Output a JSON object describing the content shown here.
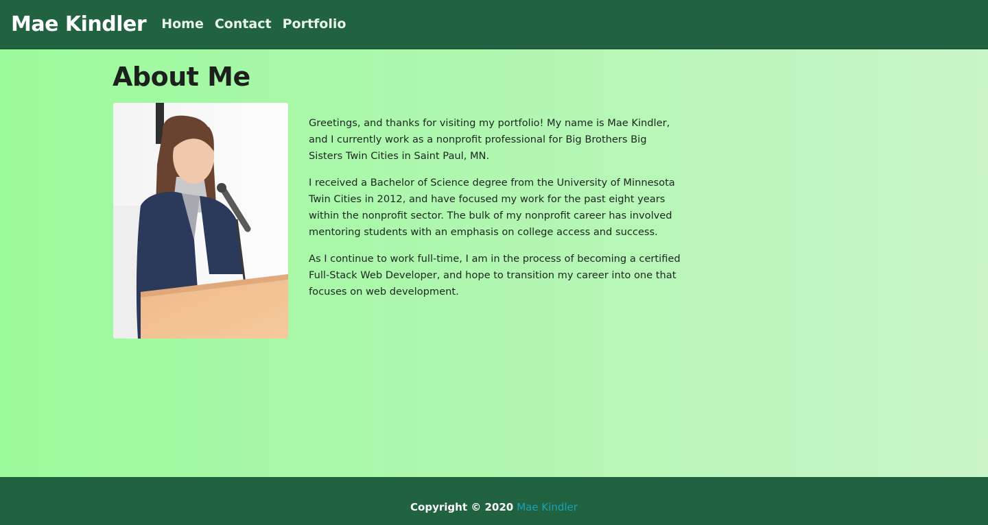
{
  "navbar": {
    "brand": "Mae Kindler",
    "links": [
      {
        "label": "Home"
      },
      {
        "label": "Contact"
      },
      {
        "label": "Portfolio"
      }
    ]
  },
  "main": {
    "title": "About Me",
    "photo": {
      "alt": "Mae Kindler speaking at a podium"
    },
    "paragraphs": [
      "Greetings, and thanks for visiting my portfolio! My name is Mae Kindler, and I currently work as a nonprofit professional for Big Brothers Big Sisters Twin Cities in Saint Paul, MN.",
      "I received a Bachelor of Science degree from the University of Minnesota Twin Cities in 2012, and have focused my work for the past eight years within the nonprofit sector. The bulk of my nonprofit career has involved mentoring students with an emphasis on college access and success.",
      "As I continue to work full-time, I am in the process of becoming a certified Full-Stack Web Developer, and hope to transition my career into one that focuses on web development."
    ]
  },
  "footer": {
    "copyright": "Copyright © 2020",
    "author_link": "Mae Kindler"
  },
  "colors": {
    "nav_bg": "#216241",
    "gradient_start": "#9bfa9b",
    "gradient_end": "#c9f5c9",
    "footer_link": "#1aa3b8"
  }
}
